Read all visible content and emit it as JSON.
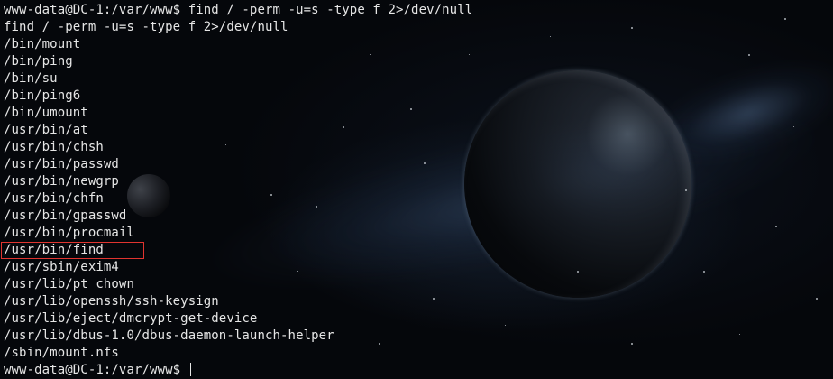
{
  "terminal": {
    "prompt": "www-data@DC-1:/var/www$",
    "command": "find / -perm -u=s -type f 2>/dev/null",
    "echo": "find / -perm -u=s -type f 2>/dev/null",
    "output": [
      "/bin/mount",
      "/bin/ping",
      "/bin/su",
      "/bin/ping6",
      "/bin/umount",
      "/usr/bin/at",
      "/usr/bin/chsh",
      "/usr/bin/passwd",
      "/usr/bin/newgrp",
      "/usr/bin/chfn",
      "/usr/bin/gpasswd",
      "/usr/bin/procmail",
      "/usr/bin/find",
      "/usr/sbin/exim4",
      "/usr/lib/pt_chown",
      "/usr/lib/openssh/ssh-keysign",
      "/usr/lib/eject/dmcrypt-get-device",
      "/usr/lib/dbus-1.0/dbus-daemon-launch-helper",
      "/sbin/mount.nfs"
    ],
    "final_prompt": "www-data@DC-1:/var/www$",
    "highlighted_line": "/usr/bin/find"
  },
  "colors": {
    "text": "#e6e6e6",
    "highlight_border": "#e0342f",
    "background": "#05070b"
  }
}
